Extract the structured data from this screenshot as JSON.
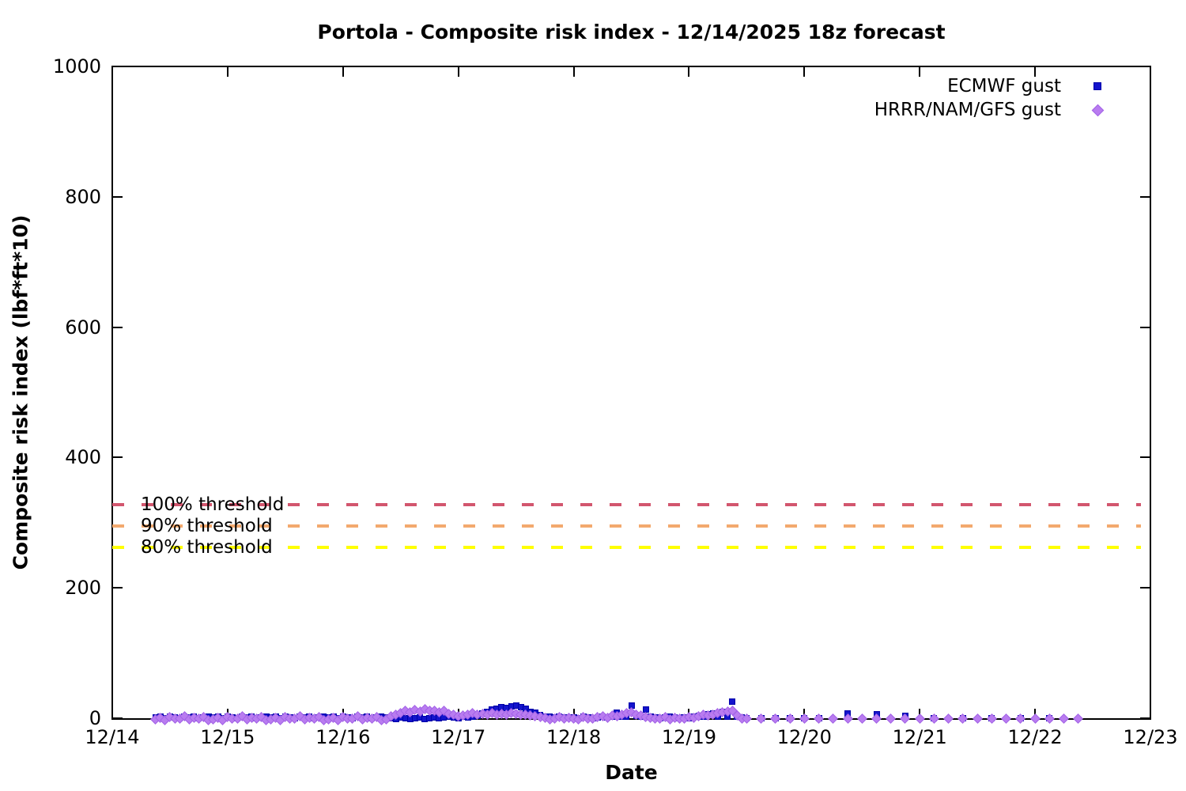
{
  "chart_data": {
    "type": "scatter",
    "title": "Portola - Composite risk index - 12/14/2025 18z forecast",
    "xlabel": "Date",
    "ylabel": "Composite risk index (lbf*ft*10)",
    "x_axis": {
      "tick_labels": [
        "12/14",
        "12/15",
        "12/16",
        "12/17",
        "12/18",
        "12/19",
        "12/20",
        "12/21",
        "12/22",
        "12/23"
      ],
      "tick_days": [
        0,
        1,
        2,
        3,
        4,
        5,
        6,
        7,
        8,
        9
      ],
      "unit": "days after 12/14"
    },
    "y_axis": {
      "ylim": [
        0,
        1000
      ],
      "tick_values": [
        0,
        200,
        400,
        600,
        800,
        1000
      ],
      "tick_labels": [
        "0",
        "200",
        "400",
        "600",
        "800",
        "1000"
      ]
    },
    "grid": "off",
    "legend_position": "top-right-inside",
    "thresholds": [
      {
        "label": "100% threshold",
        "value": 328,
        "color": "#d2566e"
      },
      {
        "label": "90% threshold",
        "value": 295,
        "color": "#f3a96e"
      },
      {
        "label": "80% threshold",
        "value": 262,
        "color": "#ffff00"
      }
    ],
    "series": [
      {
        "name": "ECMWF gust",
        "marker": "square",
        "color": "#1414cc",
        "edge_color": "#0000aa",
        "dense": {
          "x_start_day": 0.375,
          "x_step_day": 0.0416667,
          "values": [
            1,
            2,
            0,
            3,
            1,
            0,
            2,
            1,
            3,
            0,
            1,
            2,
            1,
            2,
            0,
            3,
            1,
            0,
            2,
            1,
            3,
            0,
            1,
            2,
            1,
            2,
            0,
            3,
            1,
            0,
            2,
            1,
            3,
            0,
            1,
            2,
            1,
            2,
            0,
            3,
            1,
            0,
            2,
            1,
            3,
            0,
            1,
            2,
            1,
            0,
            -1,
            1,
            0,
            -1,
            0,
            1,
            -1,
            0,
            1,
            0,
            1,
            2,
            1,
            0,
            2,
            1,
            2,
            4,
            7,
            10,
            13,
            15,
            17,
            16,
            18,
            19,
            17,
            14,
            10,
            8,
            5,
            3,
            2,
            1,
            2,
            1,
            1,
            1,
            0,
            2,
            1,
            0,
            1,
            2,
            1,
            3,
            8,
            3,
            2,
            19,
            4,
            2,
            13,
            2,
            1,
            0,
            1,
            2,
            1,
            0,
            1,
            0,
            2,
            4,
            2,
            6,
            7,
            3,
            10,
            3,
            25,
            2,
            1
          ]
        },
        "sparse": [
          [
            5.5,
            0
          ],
          [
            5.625,
            0
          ],
          [
            5.75,
            0
          ],
          [
            5.875,
            0
          ],
          [
            6.0,
            0
          ],
          [
            6.125,
            0
          ],
          [
            6.375,
            7
          ],
          [
            6.625,
            6
          ],
          [
            6.875,
            4
          ],
          [
            7.125,
            0
          ],
          [
            7.375,
            0
          ],
          [
            7.625,
            0
          ],
          [
            7.875,
            0
          ],
          [
            8.125,
            0
          ]
        ]
      },
      {
        "name": "HRRR/NAM/GFS gust",
        "marker": "diamond",
        "color": "#b97cf0",
        "edge_color": "#a263e6",
        "dense": {
          "x_start_day": 0.375,
          "x_step_day": 0.0416667,
          "values": [
            -2,
            1,
            -3,
            2,
            0,
            -1,
            3,
            -2,
            1,
            -1,
            2,
            -3,
            -2,
            1,
            -3,
            2,
            0,
            -1,
            3,
            -2,
            1,
            -1,
            2,
            -3,
            -2,
            1,
            -3,
            2,
            0,
            -1,
            3,
            -2,
            1,
            -1,
            2,
            -3,
            -2,
            1,
            -3,
            2,
            0,
            -1,
            3,
            -2,
            1,
            -1,
            2,
            -3,
            -2,
            3,
            5,
            8,
            11,
            9,
            13,
            10,
            14,
            11,
            12,
            9,
            11,
            7,
            5,
            3,
            4,
            5,
            8,
            6,
            7,
            6,
            8,
            5,
            7,
            6,
            8,
            7,
            5,
            6,
            4,
            3,
            2,
            1,
            -2,
            0,
            2,
            -1,
            1,
            0,
            -2,
            2,
            0,
            -1,
            2,
            3,
            1,
            4,
            3,
            5,
            8,
            9,
            6,
            4,
            2,
            1,
            -1,
            0,
            2,
            -2,
            1,
            0,
            -1,
            2,
            1,
            3,
            5,
            4,
            6,
            8,
            9,
            10,
            11,
            4,
            -1
          ]
        },
        "sparse": [
          [
            5.5,
            0
          ],
          [
            5.625,
            -1
          ],
          [
            5.75,
            0
          ],
          [
            5.875,
            -1
          ],
          [
            6.0,
            0
          ],
          [
            6.125,
            -1
          ],
          [
            6.25,
            0
          ],
          [
            6.375,
            -1
          ],
          [
            6.5,
            0
          ],
          [
            6.625,
            -1
          ],
          [
            6.75,
            0
          ],
          [
            6.875,
            -1
          ],
          [
            7.0,
            0
          ],
          [
            7.125,
            -1
          ],
          [
            7.25,
            0
          ],
          [
            7.375,
            -1
          ],
          [
            7.5,
            0
          ],
          [
            7.625,
            -1
          ],
          [
            7.75,
            0
          ],
          [
            7.875,
            -1
          ],
          [
            8.0,
            0
          ],
          [
            8.125,
            -1
          ],
          [
            8.25,
            0
          ],
          [
            8.375,
            -1
          ]
        ]
      }
    ]
  }
}
